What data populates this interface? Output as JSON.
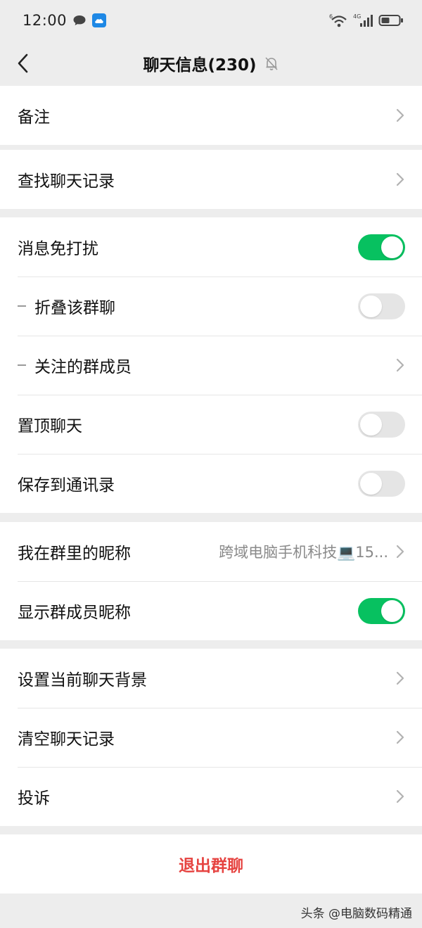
{
  "status_bar": {
    "time": "12:00",
    "wifi_badge": "6",
    "network": "4G"
  },
  "header": {
    "title": "聊天信息(230)"
  },
  "groups": [
    {
      "rows": [
        {
          "label": "备注",
          "type": "chevron"
        }
      ]
    },
    {
      "rows": [
        {
          "label": "查找聊天记录",
          "type": "chevron"
        }
      ]
    },
    {
      "rows": [
        {
          "label": "消息免打扰",
          "type": "toggle",
          "checked": true
        },
        {
          "label": "折叠该群聊",
          "type": "toggle",
          "checked": false,
          "sub": true
        },
        {
          "label": "关注的群成员",
          "type": "chevron",
          "sub": true
        },
        {
          "label": "置顶聊天",
          "type": "toggle",
          "checked": false
        },
        {
          "label": "保存到通讯录",
          "type": "toggle",
          "checked": false
        }
      ]
    },
    {
      "rows": [
        {
          "label": "我在群里的昵称",
          "type": "chevron",
          "value": "跨域电脑手机科技💻15..."
        },
        {
          "label": "显示群成员昵称",
          "type": "toggle",
          "checked": true
        }
      ]
    },
    {
      "rows": [
        {
          "label": "设置当前聊天背景",
          "type": "chevron"
        },
        {
          "label": "清空聊天记录",
          "type": "chevron"
        },
        {
          "label": "投诉",
          "type": "chevron"
        }
      ]
    }
  ],
  "exit": {
    "label": "退出群聊"
  },
  "watermark": "头条 @电脑数码精通",
  "colors": {
    "toggle_on": "#07c160",
    "toggle_off": "#e5e5e5",
    "exit_text": "#e64340",
    "chevron": "#b2b2b2",
    "icon_grey": "#444444"
  },
  "icons": {
    "back": "chevron-left-icon",
    "mute": "bell-off-icon",
    "chevron": "chevron-right-icon",
    "message": "chat-bubble-icon",
    "weather": "cloud-icon",
    "wifi": "wifi-icon",
    "signal": "signal-icon",
    "battery": "battery-icon"
  }
}
